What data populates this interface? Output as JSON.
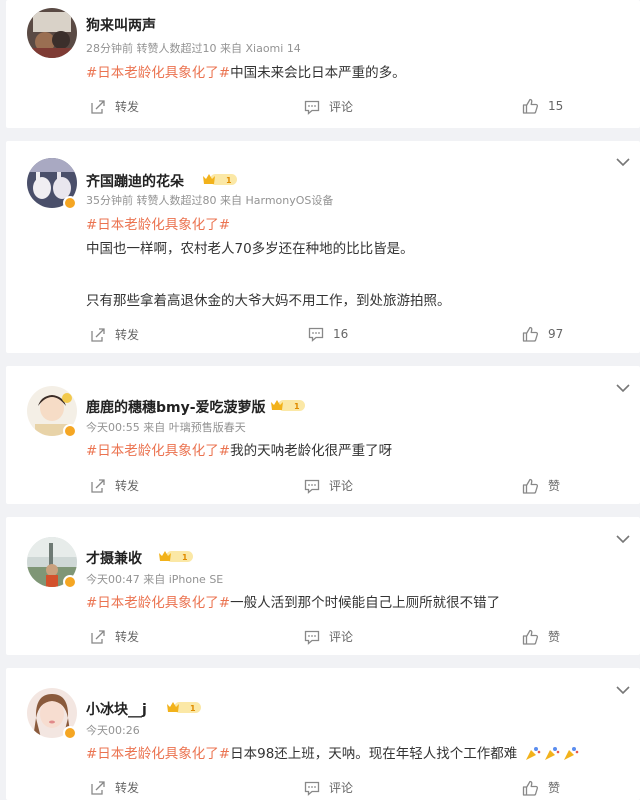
{
  "posts": [
    {
      "username": "狗来叫两声",
      "meta": "28分钟前 转赞人数超过10  来自 Xiaomi 14",
      "topic": "#日本老龄化具象化了#",
      "text_inline": "中国未来会比日本严重的多。",
      "repost_label": "转发",
      "comment_label": "评论",
      "like_label": "15"
    },
    {
      "username": "齐国蹦迪的花朵",
      "level": "1",
      "meta": "35分钟前 转赞人数超过80  来自 HarmonyOS设备",
      "topic": "#日本老龄化具象化了#",
      "line1": "中国也一样啊，农村老人70多岁还在种地的比比皆是。",
      "line2": "只有那些拿着高退休金的大爷大妈不用工作，到处旅游拍照。",
      "repost_label": "转发",
      "comment_label": "16",
      "like_label": "97"
    },
    {
      "username": "鹿鹿的穗穗bmy-爱吃菠萝版",
      "level": "1",
      "meta": "今天00:55  来自 叶璃预售版春天",
      "topic": "#日本老龄化具象化了#",
      "text_inline": "我的天呐老龄化很严重了呀",
      "repost_label": "转发",
      "comment_label": "评论",
      "like_label": "赞"
    },
    {
      "username": "才摄兼收",
      "level": "1",
      "meta": "今天00:47  来自 iPhone SE",
      "topic": "#日本老龄化具象化了#",
      "text_inline": "一般人活到那个时候能自己上厕所就很不错了",
      "repost_label": "转发",
      "comment_label": "评论",
      "like_label": "赞"
    },
    {
      "username": "小冰块__j",
      "level": "1",
      "meta": "今天00:26",
      "topic": "#日本老龄化具象化了#",
      "text_inline": "日本98还上班，天呐。现在年轻人找个工作都难",
      "repost_label": "转发",
      "comment_label": "评论",
      "like_label": "赞"
    }
  ],
  "colors": {
    "topic": "#eb7350",
    "background": "#f1f2f5",
    "verified_badge": "#f5a623"
  },
  "icons": [
    "repost-icon",
    "comment-icon",
    "like-icon",
    "chevron-down-icon",
    "level-crown-icon",
    "verified-badge-icon",
    "party-popper-emoji"
  ]
}
